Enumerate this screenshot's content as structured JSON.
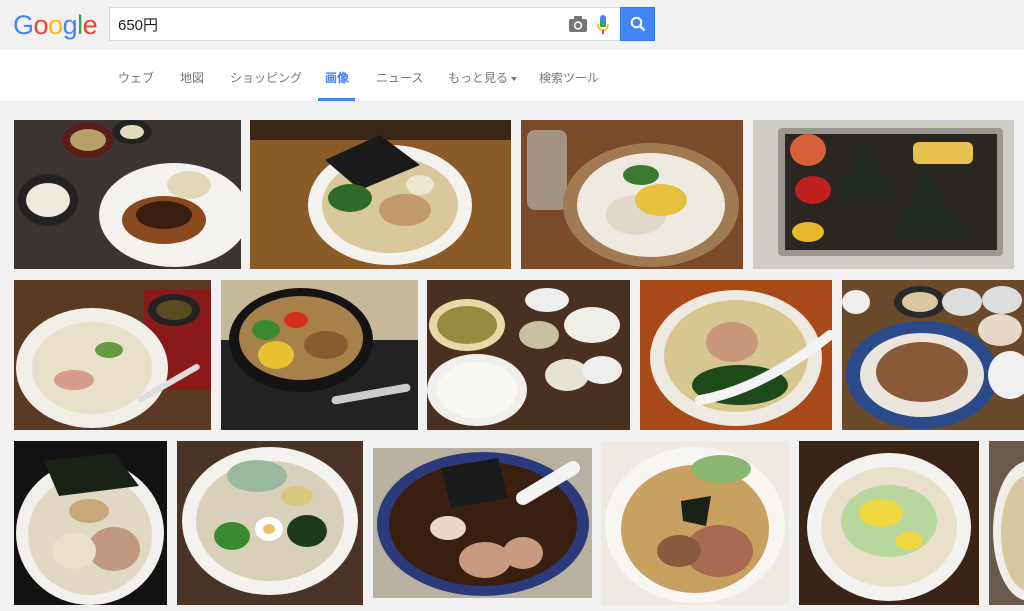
{
  "logo": "Google",
  "search": {
    "value": "650円"
  },
  "nav": {
    "tabs": [
      {
        "label": "ウェブ"
      },
      {
        "label": "地図"
      },
      {
        "label": "ショッピング"
      },
      {
        "label": "画像"
      },
      {
        "label": "ニュース"
      },
      {
        "label": "もっと見る"
      },
      {
        "label": "検索ツール"
      }
    ],
    "active_tab": "画像"
  },
  "colors": {
    "accent": "#4285f4",
    "logo_blue": "#4285f4",
    "logo_red": "#ea4335",
    "logo_yellow": "#fbbc05",
    "logo_green": "#34a853"
  },
  "results": [
    {
      "dish": "katsu-teishoku"
    },
    {
      "dish": "ramen-nori"
    },
    {
      "dish": "hiyashi-ramen"
    },
    {
      "dish": "onigiri-bento"
    },
    {
      "dish": "yasai-ramen"
    },
    {
      "dish": "gyudon-vegetables"
    },
    {
      "dish": "teishoku-set"
    },
    {
      "dish": "tonkotsu-ramen"
    },
    {
      "dish": "butadon-set"
    },
    {
      "dish": "shio-ramen"
    },
    {
      "dish": "hiyashi-egg-ramen"
    },
    {
      "dish": "shoyu-ramen"
    },
    {
      "dish": "tsukemen-chashu"
    },
    {
      "dish": "corn-miso-ramen"
    },
    {
      "dish": "partial-ramen"
    }
  ]
}
